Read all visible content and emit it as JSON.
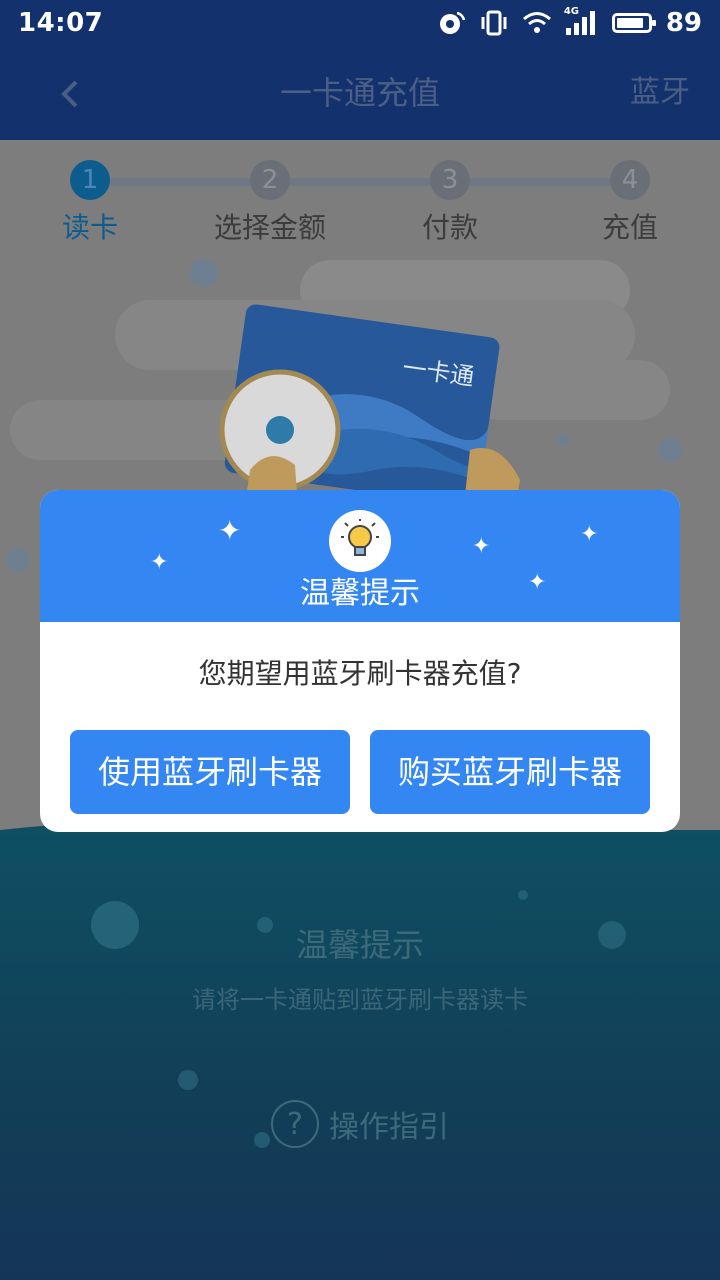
{
  "status": {
    "time": "14:07",
    "network": "4G",
    "battery": "89",
    "battery_fraction": 0.89
  },
  "header": {
    "title": "一卡通充值",
    "right_action": "蓝牙"
  },
  "steps": [
    {
      "number": "1",
      "label": "读卡"
    },
    {
      "number": "2",
      "label": "选择金额"
    },
    {
      "number": "3",
      "label": "付款"
    },
    {
      "number": "4",
      "label": "充值"
    }
  ],
  "active_step": 1,
  "illustration": {
    "card_text": "一卡通"
  },
  "background_tip": {
    "title": "温馨提示",
    "subtitle": "请将一卡通贴到蓝牙刷卡器读卡",
    "guide_label": "操作指引",
    "guide_icon_glyph": "?"
  },
  "dialog": {
    "title": "温馨提示",
    "message": "您期望用蓝牙刷卡器充值?",
    "left_button": "使用蓝牙刷卡器",
    "right_button": "购买蓝牙刷卡器",
    "sparkle_glyph": "✦"
  },
  "colors": {
    "header_bg": "#12316d",
    "dialog_accent": "#3487f3",
    "active_step": "#0d5c8e"
  }
}
